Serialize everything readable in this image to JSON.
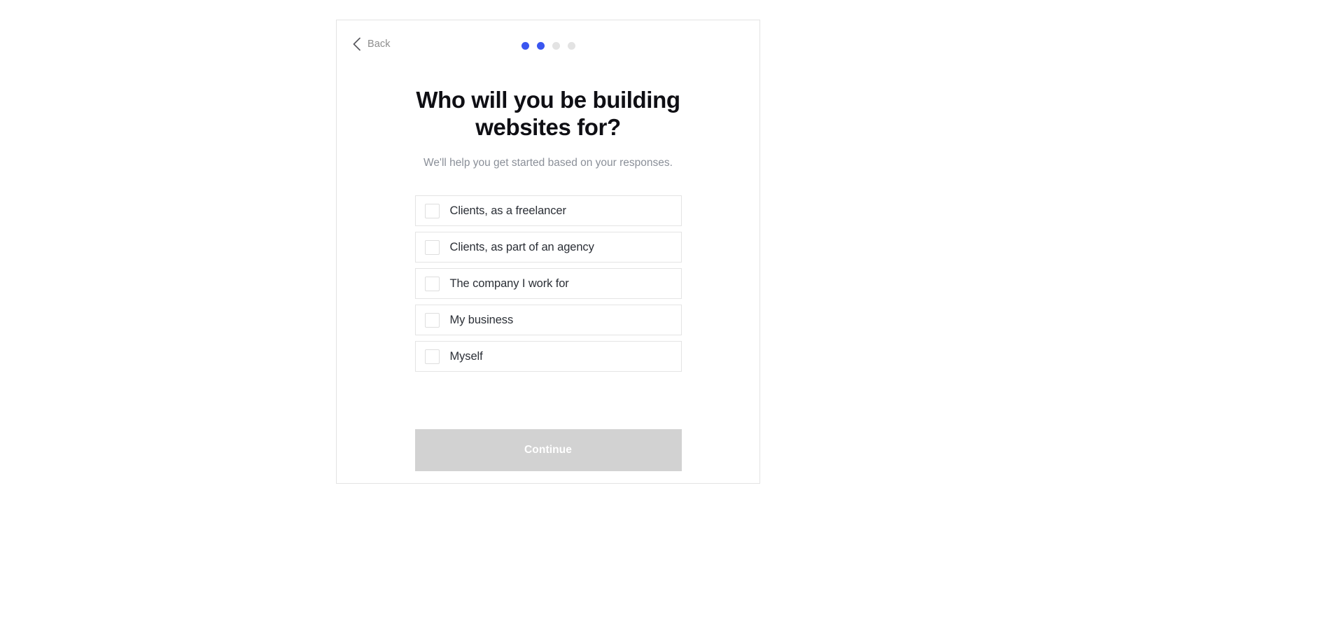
{
  "colors": {
    "accent": "#3a56f0",
    "dot_inactive": "#e3e3e3",
    "card_border": "#e3e3e3",
    "option_border": "#e4e4e4",
    "button_disabled_bg": "#d2d2d2",
    "button_disabled_text": "#ffffff",
    "heading_text": "#0f0f14",
    "subhead_text": "#8a8f98",
    "option_text": "#2b2f36",
    "back_text": "#8d8d8d",
    "page_background": "#ffffff"
  },
  "header": {
    "back_label": "Back",
    "back_icon": "chevron-left-icon",
    "progress": {
      "total_steps": 4,
      "current_step": 2,
      "steps": [
        {
          "index": 1,
          "state": "active"
        },
        {
          "index": 2,
          "state": "active"
        },
        {
          "index": 3,
          "state": "inactive"
        },
        {
          "index": 4,
          "state": "inactive"
        }
      ]
    }
  },
  "main": {
    "heading": "Who will you be building websites for?",
    "subheading": "We'll help you get started based on your responses.",
    "options": [
      {
        "label": "Clients, as a freelancer",
        "checked": false
      },
      {
        "label": "Clients, as part of an agency",
        "checked": false
      },
      {
        "label": "The company I work for",
        "checked": false
      },
      {
        "label": "My business",
        "checked": false
      },
      {
        "label": "Myself",
        "checked": false
      }
    ],
    "continue_label": "Continue",
    "continue_enabled": false
  }
}
